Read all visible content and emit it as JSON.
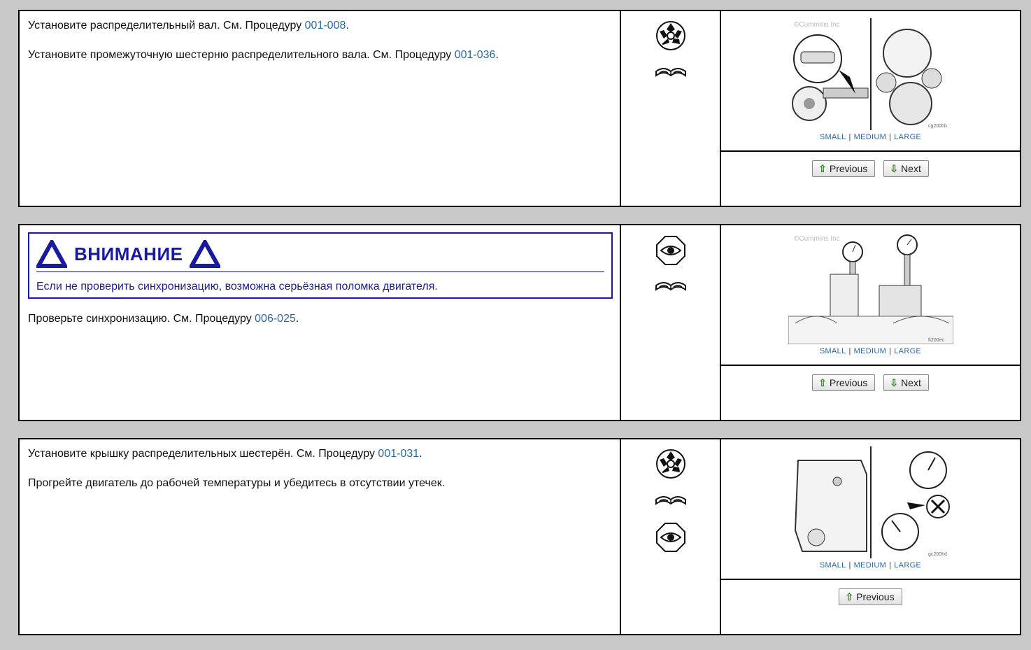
{
  "steps": [
    {
      "lines": [
        {
          "text": "Установите распределительный вал. См. Процедуру ",
          "ref": "001-008",
          "suffix": "."
        },
        {
          "text": "Установите промежуточную шестерню распределительного вала. См. Процедуру ",
          "ref": "001-036",
          "suffix": "."
        }
      ],
      "icons": [
        "gear-wrench-icon",
        "manual-book-icon"
      ],
      "size_links": [
        "SMALL",
        "MEDIUM",
        "LARGE"
      ],
      "buttons": {
        "previous": "Previous",
        "next": "Next"
      }
    },
    {
      "warning": {
        "title": "ВНИМАНИЕ",
        "text": "Если не проверить синхронизацию, возможна серьёзная поломка двигателя."
      },
      "lines": [
        {
          "text": "Проверьте синхронизацию. См. Процедуру ",
          "ref": "006-025",
          "suffix": "."
        }
      ],
      "icons": [
        "inspect-eye-icon",
        "manual-book-icon"
      ],
      "size_links": [
        "SMALL",
        "MEDIUM",
        "LARGE"
      ],
      "buttons": {
        "previous": "Previous",
        "next": "Next"
      }
    },
    {
      "lines": [
        {
          "text": "Установите крышку распределительных шестерён. См. Процедуру ",
          "ref": "001-031",
          "suffix": "."
        },
        {
          "text": "Прогрейте двигатель до рабочей температуры и убедитесь в отсутствии утечек.",
          "ref": "",
          "suffix": ""
        }
      ],
      "icons": [
        "gear-wrench-icon",
        "manual-book-icon",
        "inspect-eye-icon"
      ],
      "size_links": [
        "SMALL",
        "MEDIUM",
        "LARGE"
      ],
      "buttons": {
        "previous": "Previous"
      }
    }
  ],
  "figure_watermark": "©Cummins Inc",
  "figure_codes": [
    "cg200hb",
    "ft200ec",
    "gc200hd"
  ],
  "colors": {
    "link": "#2a6aa8",
    "warning": "#1a1aa0",
    "background": "#c8c8c8"
  }
}
